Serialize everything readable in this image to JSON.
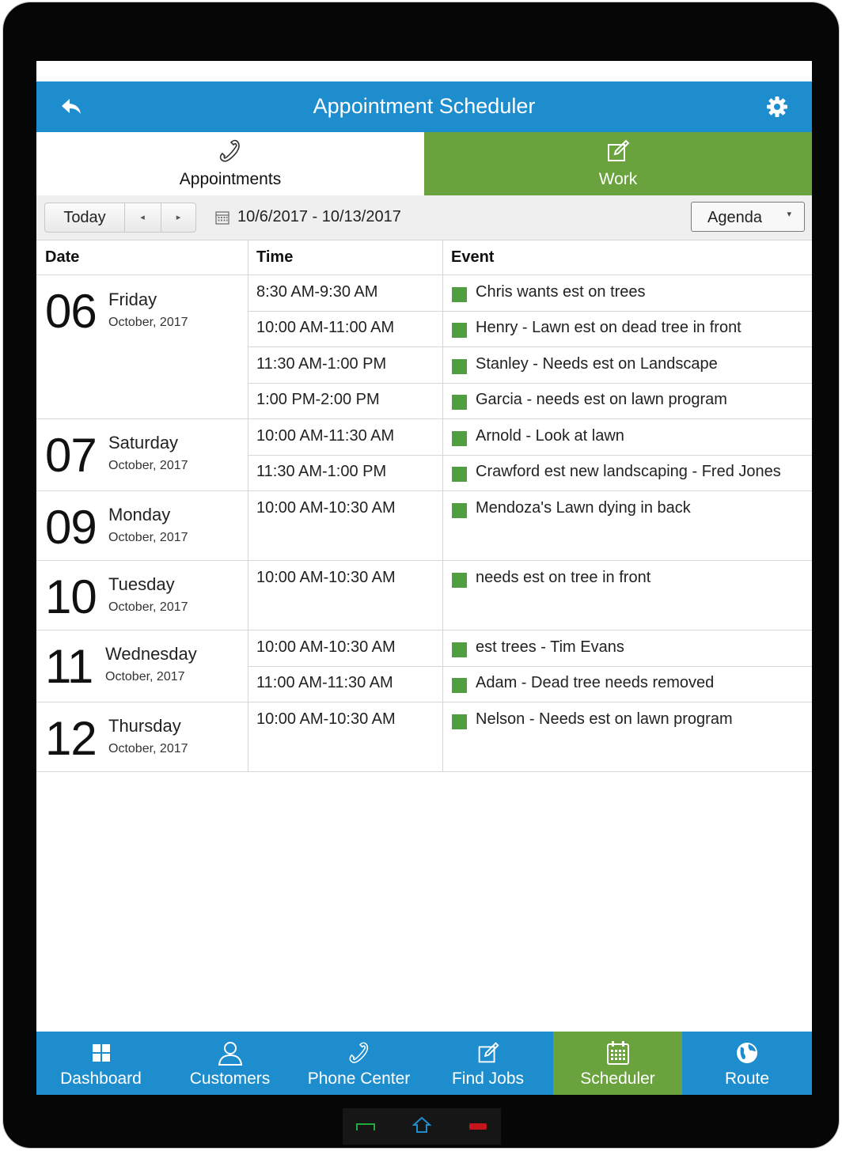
{
  "app": {
    "title": "Appointment Scheduler"
  },
  "tabs": [
    {
      "label": "Appointments",
      "icon": "phone-icon",
      "active": true
    },
    {
      "label": "Work",
      "icon": "edit-icon",
      "active": false
    }
  ],
  "toolbar": {
    "today_label": "Today",
    "prev_glyph": "◂",
    "next_glyph": "▸",
    "date_range": "10/6/2017 - 10/13/2017",
    "view_select": "Agenda",
    "caret_glyph": "▾"
  },
  "columns": {
    "date": "Date",
    "time": "Time",
    "event": "Event"
  },
  "days": [
    {
      "num": "06",
      "name": "Friday",
      "month": "October, 2017",
      "events": [
        {
          "time": "8:30 AM-9:30 AM",
          "text": "Chris wants est on trees"
        },
        {
          "time": "10:00 AM-11:00 AM",
          "text": "Henry - Lawn est on dead tree in front"
        },
        {
          "time": "11:30 AM-1:00 PM",
          "text": "Stanley - Needs est on Landscape"
        },
        {
          "time": "1:00 PM-2:00 PM",
          "text": "Garcia - needs est on lawn program"
        }
      ]
    },
    {
      "num": "07",
      "name": "Saturday",
      "month": "October, 2017",
      "events": [
        {
          "time": "10:00 AM-11:30 AM",
          "text": "Arnold - Look at lawn"
        },
        {
          "time": "11:30 AM-1:00 PM",
          "text": "Crawford est new landscaping - Fred Jones"
        }
      ]
    },
    {
      "num": "09",
      "name": "Monday",
      "month": "October, 2017",
      "events": [
        {
          "time": "10:00 AM-10:30 AM",
          "text": "Mendoza's Lawn dying in back"
        }
      ]
    },
    {
      "num": "10",
      "name": "Tuesday",
      "month": "October, 2017",
      "events": [
        {
          "time": "10:00 AM-10:30 AM",
          "text": "needs est on tree in front"
        }
      ]
    },
    {
      "num": "11",
      "name": "Wednesday",
      "month": "October, 2017",
      "events": [
        {
          "time": "10:00 AM-10:30 AM",
          "text": "est trees - Tim Evans"
        },
        {
          "time": "11:00 AM-11:30 AM",
          "text": "Adam - Dead tree needs removed"
        }
      ]
    },
    {
      "num": "12",
      "name": "Thursday",
      "month": "October, 2017",
      "events": [
        {
          "time": "10:00 AM-10:30 AM",
          "text": "Nelson - Needs est on lawn program"
        }
      ]
    }
  ],
  "bottom_nav": [
    {
      "label": "Dashboard",
      "icon": "dashboard-icon"
    },
    {
      "label": "Customers",
      "icon": "customers-icon"
    },
    {
      "label": "Phone Center",
      "icon": "phone-icon"
    },
    {
      "label": "Find Jobs",
      "icon": "edit-icon"
    },
    {
      "label": "Scheduler",
      "icon": "calendar-icon",
      "active": true
    },
    {
      "label": "Route",
      "icon": "globe-icon"
    }
  ],
  "colors": {
    "header_blue": "#1d8dce",
    "active_green": "#6aa33d",
    "event_green": "#4f9e3f"
  }
}
